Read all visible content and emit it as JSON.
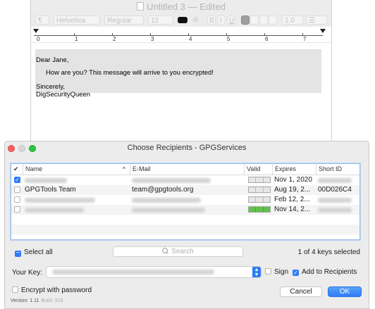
{
  "editor": {
    "title": "Untitled 3",
    "edited": "— Edited",
    "toolbar": {
      "paragraph_style": "¶",
      "font_family": "Helvetica",
      "font_style": "Regular",
      "font_size": "12",
      "bold": "B",
      "italic": "I",
      "underline": "U",
      "line_spacing": "1.0",
      "list": "☰"
    },
    "ruler_numbers": [
      "0",
      "1",
      "2",
      "3",
      "4",
      "5",
      "6",
      "7"
    ],
    "body": {
      "greeting": "Dear Jane,",
      "message": "How are you? This message will arrive to you encrypted!",
      "closing": "Sincerely,",
      "signature": "DigSecurityQueen"
    }
  },
  "dialog": {
    "title": "Choose Recipients - GPGServices",
    "table": {
      "check_header": "✔",
      "columns": {
        "name": "Name",
        "sort_indicator": "^",
        "email": "E-Mail",
        "valid": "Valid",
        "expires": "Expires",
        "short_id": "Short ID"
      },
      "rows": [
        {
          "checked": true,
          "name": "",
          "email": "",
          "valid": "empty",
          "expires": "Nov 1, 2020",
          "short_id": ""
        },
        {
          "checked": false,
          "name": "GPGTools Team",
          "email": "team@gpgtools.org",
          "valid": "empty",
          "expires": "Aug 19, 2...",
          "short_id": "00D026C4"
        },
        {
          "checked": false,
          "name": "",
          "email": "",
          "valid": "empty",
          "expires": "Feb 12, 2...",
          "short_id": ""
        },
        {
          "checked": false,
          "name": "",
          "email": "",
          "valid": "full",
          "expires": "Nov 14, 2...",
          "short_id": ""
        }
      ]
    },
    "select_all": "Select all",
    "search_placeholder": "Search",
    "keys_selected": "1 of 4 keys selected",
    "your_key_label": "Your Key:",
    "sign_label": "Sign",
    "add_to_recipients_label": "Add to Recipients",
    "encrypt_with_password_label": "Encrypt with password",
    "cancel_label": "Cancel",
    "ok_label": "OK",
    "version": "Version: 1.11",
    "build": "Build: 916",
    "colors": {
      "accent": "#2f7cf6",
      "valid_green": "#62c24b",
      "close": "#fc5f57",
      "zoom": "#2ac840"
    }
  }
}
